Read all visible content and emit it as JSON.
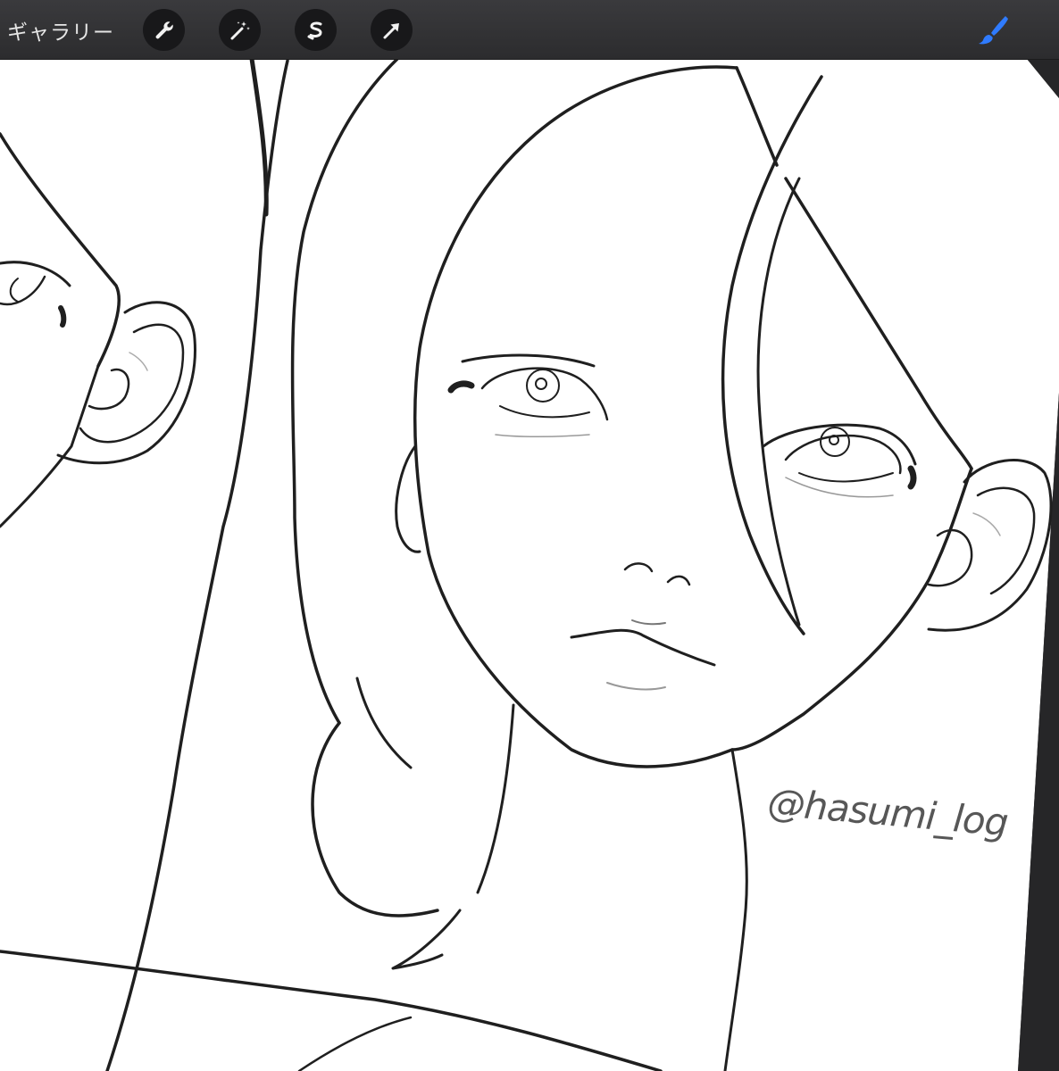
{
  "toolbar": {
    "gallery_label": "ギャラリー",
    "tools": [
      {
        "icon": "wrench-icon",
        "name": "actions"
      },
      {
        "icon": "magic-wand-icon",
        "name": "adjustments"
      },
      {
        "icon": "selection-icon",
        "name": "selection"
      },
      {
        "icon": "arrow-cursor-icon",
        "name": "transform"
      }
    ],
    "brush_icon": "paintbrush-icon"
  },
  "colors": {
    "toolbar_bg": "#2c2c2e",
    "accent": "#2f7bff",
    "paper": "#ffffff",
    "ink": "#1e1e1e"
  },
  "canvas": {
    "signature_text": "@hasumi_log"
  }
}
